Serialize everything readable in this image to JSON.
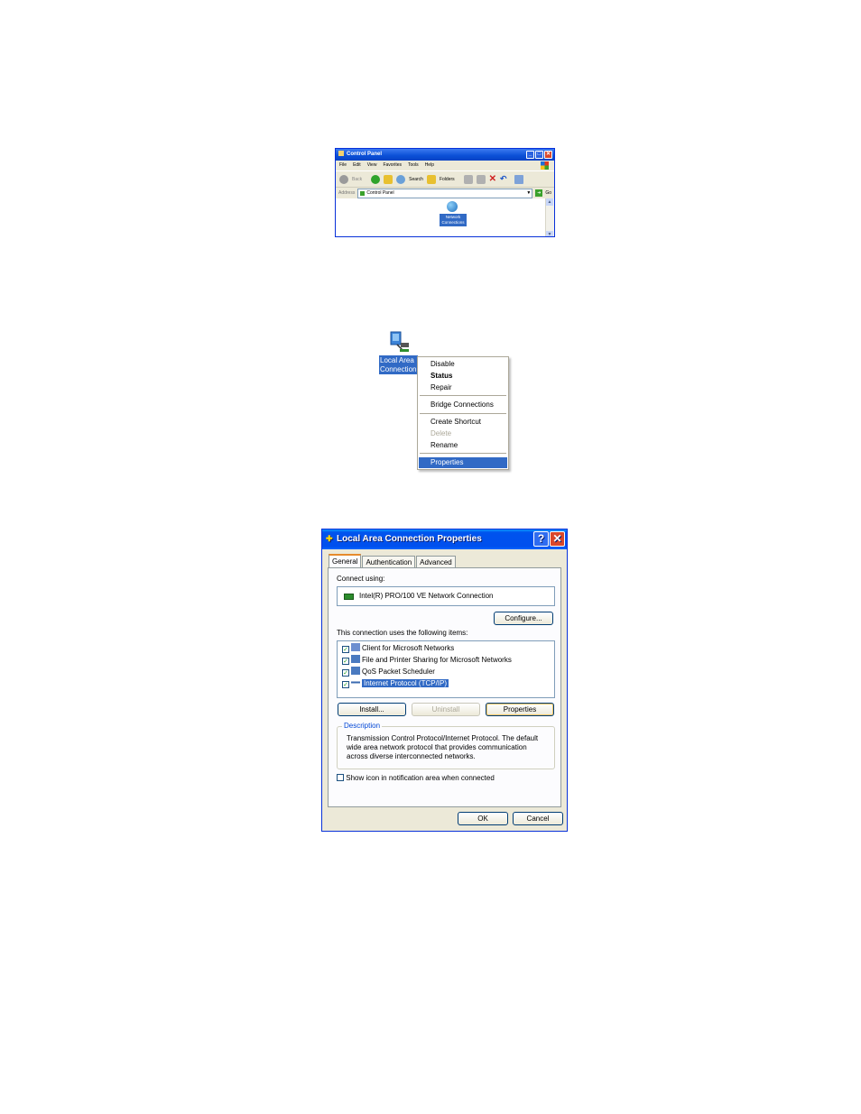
{
  "control_panel": {
    "title": "Control Panel",
    "menu": [
      "File",
      "Edit",
      "View",
      "Favorites",
      "Tools",
      "Help"
    ],
    "toolbar": {
      "back": "Back",
      "search": "Search",
      "folders": "Folders"
    },
    "address_label": "Address",
    "address_value": "Control Panel",
    "go_label": "Go",
    "item_label": "Network Connections"
  },
  "connection": {
    "label": "Local Area Connection"
  },
  "context_menu": {
    "items": [
      "Disable",
      "Status",
      "Repair",
      "Bridge Connections",
      "Create Shortcut",
      "Delete",
      "Rename",
      "Properties"
    ]
  },
  "dialog": {
    "title": "Local Area Connection Properties",
    "tabs": [
      "General",
      "Authentication",
      "Advanced"
    ],
    "connect_using_label": "Connect using:",
    "adapter": "Intel(R) PRO/100 VE Network Connection",
    "configure_label": "Configure...",
    "items_label": "This connection uses the following items:",
    "components": [
      {
        "label": "Client for Microsoft Networks",
        "checked": true
      },
      {
        "label": "File and Printer Sharing for Microsoft Networks",
        "checked": true
      },
      {
        "label": "QoS Packet Scheduler",
        "checked": true
      },
      {
        "label": "Internet Protocol (TCP/IP)",
        "checked": true
      }
    ],
    "install_label": "Install...",
    "uninstall_label": "Uninstall",
    "properties_label": "Properties",
    "description_title": "Description",
    "description_text": "Transmission Control Protocol/Internet Protocol. The default wide area network protocol that provides communication across diverse interconnected networks.",
    "show_icon_label": "Show icon in notification area when connected",
    "ok_label": "OK",
    "cancel_label": "Cancel"
  }
}
